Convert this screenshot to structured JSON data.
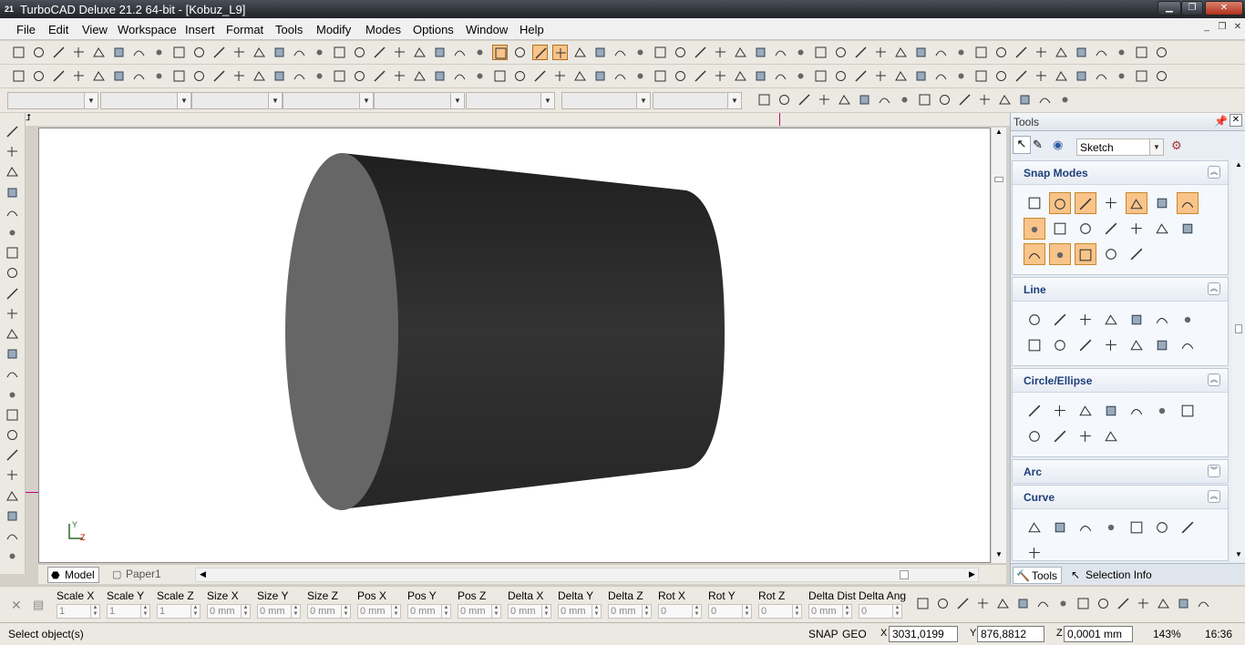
{
  "window": {
    "title": "TurboCAD Deluxe 21.2 64-bit - [Kobuz_L9]",
    "app_icon": "21"
  },
  "menubar": {
    "items": [
      "File",
      "Edit",
      "View",
      "Workspace",
      "Insert",
      "Format",
      "Tools",
      "Modify",
      "Modes",
      "Options",
      "Window",
      "Help"
    ]
  },
  "document_tabs": [
    {
      "label": "Model"
    },
    {
      "label": "Paper1"
    }
  ],
  "inspector": {
    "fields": [
      {
        "label": "Scale X",
        "value": "1"
      },
      {
        "label": "Scale Y",
        "value": "1"
      },
      {
        "label": "Scale Z",
        "value": "1"
      },
      {
        "label": "Size X",
        "value": "0 mm"
      },
      {
        "label": "Size Y",
        "value": "0 mm"
      },
      {
        "label": "Size Z",
        "value": "0 mm"
      },
      {
        "label": "Pos X",
        "value": "0 mm"
      },
      {
        "label": "Pos Y",
        "value": "0 mm"
      },
      {
        "label": "Pos Z",
        "value": "0 mm"
      },
      {
        "label": "Delta X",
        "value": "0 mm"
      },
      {
        "label": "Delta Y",
        "value": "0 mm"
      },
      {
        "label": "Delta Z",
        "value": "0 mm"
      },
      {
        "label": "Rot X",
        "value": "0"
      },
      {
        "label": "Rot Y",
        "value": "0"
      },
      {
        "label": "Rot Z",
        "value": "0"
      },
      {
        "label": "Delta Dist",
        "value": "0 mm"
      },
      {
        "label": "Delta Ang",
        "value": "0"
      }
    ]
  },
  "status": {
    "message": "Select object(s)",
    "snap": "SNAP",
    "geo": "GEO",
    "x": "3031,0199 mm",
    "y": "876,8812 mm",
    "z": "0,0001 mm",
    "zoom": "143%",
    "time": "16:36"
  },
  "panel": {
    "title": "Tools",
    "mode_select": "Sketch",
    "groups": [
      {
        "title": "Snap Modes",
        "expanded": true
      },
      {
        "title": "Line",
        "expanded": true
      },
      {
        "title": "Circle/Ellipse",
        "expanded": true
      },
      {
        "title": "Arc",
        "expanded": false
      },
      {
        "title": "Curve",
        "expanded": true
      }
    ],
    "bottom_tabs": [
      {
        "label": "Tools"
      },
      {
        "label": "Selection Info"
      }
    ]
  },
  "viewport": {
    "axis_label_y": "Y",
    "axis_label_z": "Z",
    "object_color": "#2f2f2f",
    "face_color": "#666666"
  }
}
